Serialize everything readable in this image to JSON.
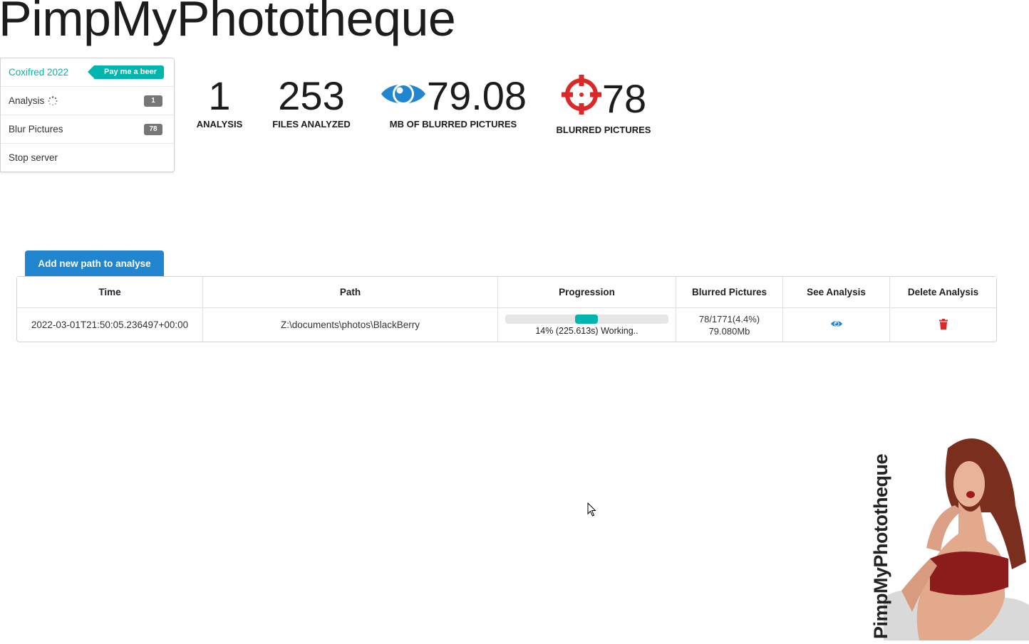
{
  "app": {
    "title": "PimpMyPhototheque"
  },
  "sidebar": {
    "items": [
      {
        "label": "Coxifred 2022",
        "tag": "Pay me a beer"
      },
      {
        "label": "Analysis",
        "badge": "1",
        "icon": "spinner-icon"
      },
      {
        "label": "Blur Pictures",
        "badge": "78"
      },
      {
        "label": "Stop server"
      }
    ]
  },
  "stats": [
    {
      "value": "1",
      "label": "ANALYSIS"
    },
    {
      "value": "253",
      "label": "FILES ANALYZED"
    },
    {
      "value": "79.08",
      "label": "MB OF BLURRED PICTURES",
      "icon": "eye-icon"
    },
    {
      "value": "78",
      "label": "BLURRED PICTURES",
      "icon": "crosshair-icon"
    }
  ],
  "actions": {
    "add_path_label": "Add new path to analyse"
  },
  "table": {
    "headers": [
      "Time",
      "Path",
      "Progression",
      "Blurred Pictures",
      "See Analysis",
      "Delete Analysis"
    ],
    "rows": [
      {
        "time": "2022-03-01T21:50:05.236497+00:00",
        "path": "Z:\\documents\\photos\\BlackBerry",
        "progress": 0.14,
        "progress_label": "14% (225.613s) Working..",
        "blurred_line1": "78/1771(4.4%)",
        "blurred_line2": "79.080Mb",
        "see_icon": "eye-icon",
        "delete_icon": "trash-icon"
      }
    ]
  },
  "logo": {
    "text": "PimpMyPhototheque"
  },
  "colors": {
    "teal": "#00b5ad",
    "blue": "#2185d0",
    "red": "#db2828",
    "badge_grey": "#767676"
  }
}
